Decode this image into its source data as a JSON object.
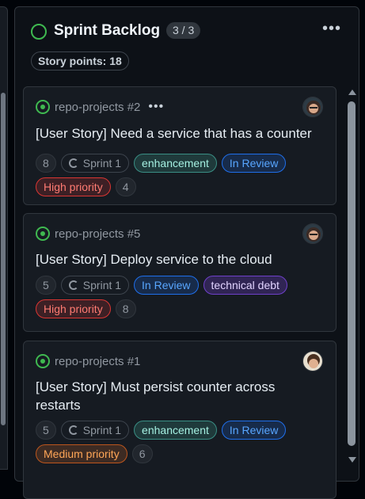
{
  "column": {
    "title": "Sprint Backlog",
    "count": "3 / 3",
    "menu_icon": "•••",
    "story_points": "Story points: 18"
  },
  "cards": [
    {
      "repo": "repo-projects #2",
      "menu_icon": "•••",
      "title": "[User Story] Need a service that has a counter",
      "tokens": [
        "8",
        "Sprint 1",
        "enhancement",
        "In Review",
        "High priority",
        "4"
      ]
    },
    {
      "repo": "repo-projects #5",
      "title": "[User Story] Deploy service to the cloud",
      "tokens": [
        "5",
        "Sprint 1",
        "In Review",
        "technical debt",
        "High priority",
        "8"
      ]
    },
    {
      "repo": "repo-projects #1",
      "title": "[User Story] Must persist counter across restarts",
      "tokens": [
        "5",
        "Sprint 1",
        "enhancement",
        "In Review",
        "Medium priority",
        "6"
      ]
    }
  ],
  "colors": {
    "open": "#3fb950",
    "in_review": "#58a6ff",
    "high_priority": "#ff7b72",
    "medium_priority": "#ffa657"
  }
}
